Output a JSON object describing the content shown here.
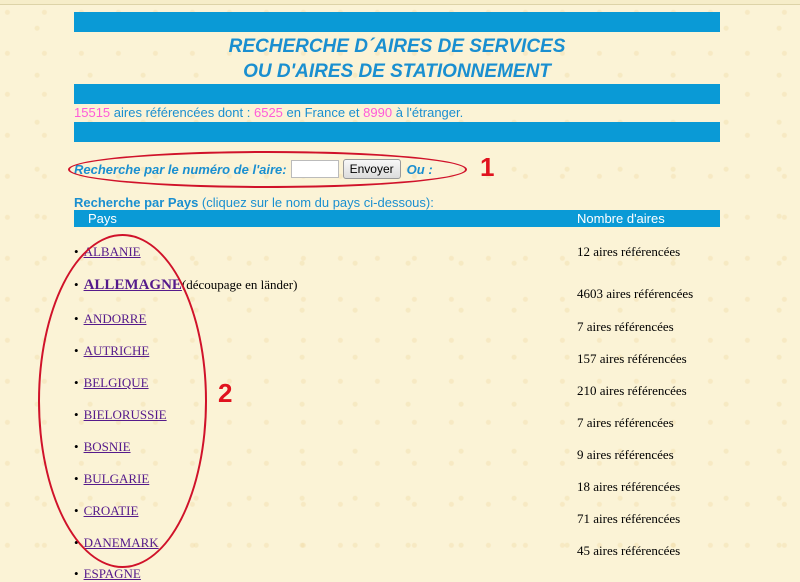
{
  "header": {
    "title_line1": "RECHERCHE D´AIRES DE SERVICES",
    "title_line2": "OU D'AIRES DE STATIONNEMENT"
  },
  "stats": {
    "total": "15515",
    "text1": "aires référencées dont :",
    "france": "6525",
    "text2": "en France et",
    "etranger": "8990",
    "text3": "à l'étranger."
  },
  "search": {
    "label": "Recherche par le numéro de l'aire:",
    "button_label": "Envoyer",
    "or_label": "Ou :",
    "input_value": ""
  },
  "country_search": {
    "bold_label": "Recherche par Pays",
    "rest_label": "(cliquez sur le nom du pays ci-dessous):"
  },
  "table": {
    "col_pays": "Pays",
    "col_nombre": "Nombre d'aires",
    "rows": [
      {
        "name": "ALBANIE",
        "count": "12 aires référencées"
      },
      {
        "name": "ALLEMAGNE",
        "note": "(découpage en länder)",
        "count": "4603 aires référencées"
      },
      {
        "name": "ANDORRE",
        "count": "7 aires référencées"
      },
      {
        "name": "AUTRICHE",
        "count": "157 aires référencées"
      },
      {
        "name": "BELGIQUE",
        "count": "210 aires référencées"
      },
      {
        "name": "BIELORUSSIE",
        "count": "7 aires référencées"
      },
      {
        "name": "BOSNIE",
        "count": "9 aires référencées"
      },
      {
        "name": "BULGARIE",
        "count": "18 aires référencées"
      },
      {
        "name": "CROATIE",
        "count": "71 aires référencées"
      },
      {
        "name": "DANEMARK",
        "count": "45 aires référencées"
      },
      {
        "name": "ESPAGNE",
        "count": ""
      }
    ]
  },
  "annotations": {
    "label1": "1",
    "label2": "2",
    "color": "#d0122a"
  },
  "colors": {
    "band": "#0a9ad6",
    "title": "#1a8fd0",
    "highlight": "#ff5bd8",
    "link": "#551a8b",
    "background": "#fbf3d6"
  }
}
